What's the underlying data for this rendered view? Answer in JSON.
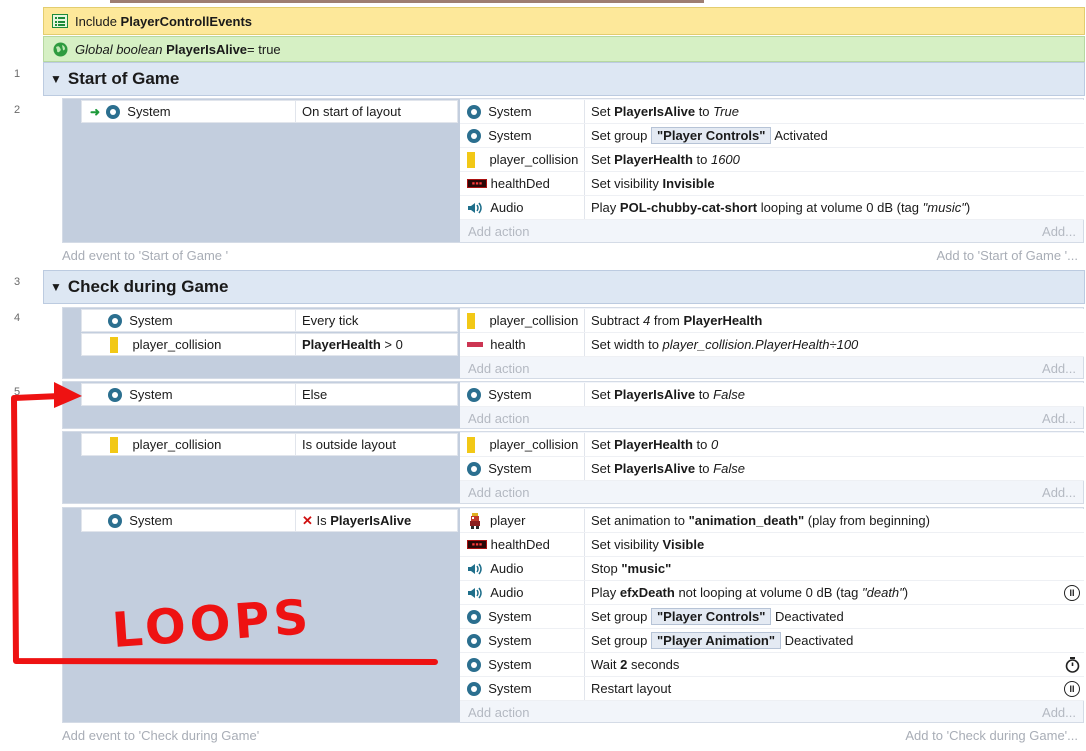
{
  "include": {
    "prefix": "Include",
    "name": "PlayerControllEvents"
  },
  "global": {
    "type": "Global boolean",
    "name": "PlayerIsAlive",
    "rest": " = true"
  },
  "line_numbers": [
    "1",
    "2",
    "3",
    "4",
    "5"
  ],
  "groups": {
    "start": {
      "title": "Start of Game",
      "add_event": "Add event to 'Start of Game '",
      "add_to": "Add to 'Start of Game '..."
    },
    "check": {
      "title": "Check during Game",
      "add_event": "Add event to 'Check during Game'",
      "add_to": "Add to 'Check during Game'..."
    }
  },
  "add_action": "Add action",
  "add_short": "Add...",
  "ev1": {
    "cond": {
      "object": "System",
      "text": "On start of layout"
    },
    "actions": [
      {
        "object": "System",
        "pre": "Set ",
        "b1": "PlayerIsAlive",
        "mid": " to ",
        "i1": "True"
      },
      {
        "object": "System",
        "pre": "Set group ",
        "tag": "\"Player Controls\"",
        "post": " Activated"
      },
      {
        "object": "player_collision",
        "pre": "Set ",
        "b1": "PlayerHealth",
        "mid": " to ",
        "i1": "1600"
      },
      {
        "object": "healthDed",
        "pre": "Set visibility ",
        "b1": "Invisible"
      },
      {
        "object": "Audio",
        "pre": "Play ",
        "b1": "POL-chubby-cat-short",
        "mid": " looping at volume 0 dB (tag ",
        "i1": "\"music\"",
        "post": ")"
      }
    ]
  },
  "ev2": {
    "conds": [
      {
        "object": "System",
        "text": "Every tick"
      },
      {
        "object": "player_collision",
        "b": "PlayerHealth",
        "rest": " > 0"
      }
    ],
    "actions": [
      {
        "object": "player_collision",
        "pre": "Subtract ",
        "i1": "4",
        "mid": " from ",
        "b1": "PlayerHealth"
      },
      {
        "object": "health",
        "pre": "Set width to ",
        "i1": "player_collision.PlayerHealth÷100"
      }
    ]
  },
  "ev3": {
    "cond": {
      "object": "System",
      "text": "Else"
    },
    "actions": [
      {
        "object": "System",
        "pre": "Set ",
        "b1": "PlayerIsAlive",
        "mid": " to ",
        "i1": "False"
      }
    ]
  },
  "ev4": {
    "cond": {
      "object": "player_collision",
      "text": "Is outside layout"
    },
    "actions": [
      {
        "object": "player_collision",
        "pre": "Set ",
        "b1": "PlayerHealth",
        "mid": " to ",
        "i1": "0"
      },
      {
        "object": "System",
        "pre": "Set ",
        "b1": "PlayerIsAlive",
        "mid": " to ",
        "i1": "False"
      }
    ]
  },
  "ev5": {
    "cond": {
      "object": "System",
      "neg": "✕",
      "pre": "Is ",
      "b": "PlayerIsAlive"
    },
    "actions": [
      {
        "object": "player",
        "pre": "Set animation to ",
        "b1": "\"animation_death\"",
        "post": " (play from beginning)"
      },
      {
        "object": "healthDed",
        "pre": "Set visibility ",
        "b1": "Visible"
      },
      {
        "object": "Audio",
        "pre": "Stop ",
        "b1": "\"music\""
      },
      {
        "object": "Audio",
        "pre": "Play ",
        "b1": "efxDeath",
        "mid": " not looping at volume 0 dB (tag ",
        "i1": "\"death\"",
        "post": ")"
      },
      {
        "object": "System",
        "pre": "Set group ",
        "tag": "\"Player Controls\"",
        "post": " Deactivated"
      },
      {
        "object": "System",
        "pre": "Set group ",
        "tag": "\"Player Animation\"",
        "post": " Deactivated"
      },
      {
        "object": "System",
        "pre": "Wait ",
        "b1": "2",
        "post": " seconds"
      },
      {
        "object": "System",
        "pre": "Restart layout"
      }
    ]
  },
  "annotation": {
    "text": "LOOPS",
    "color": "#ee1212"
  },
  "colors": {
    "include_bg": "#fde89a",
    "global_bg": "#d6f0c4",
    "group_bg": "#dde7f3",
    "condition_panel": "#c3cede",
    "system_icon": "#2b6f8f"
  }
}
